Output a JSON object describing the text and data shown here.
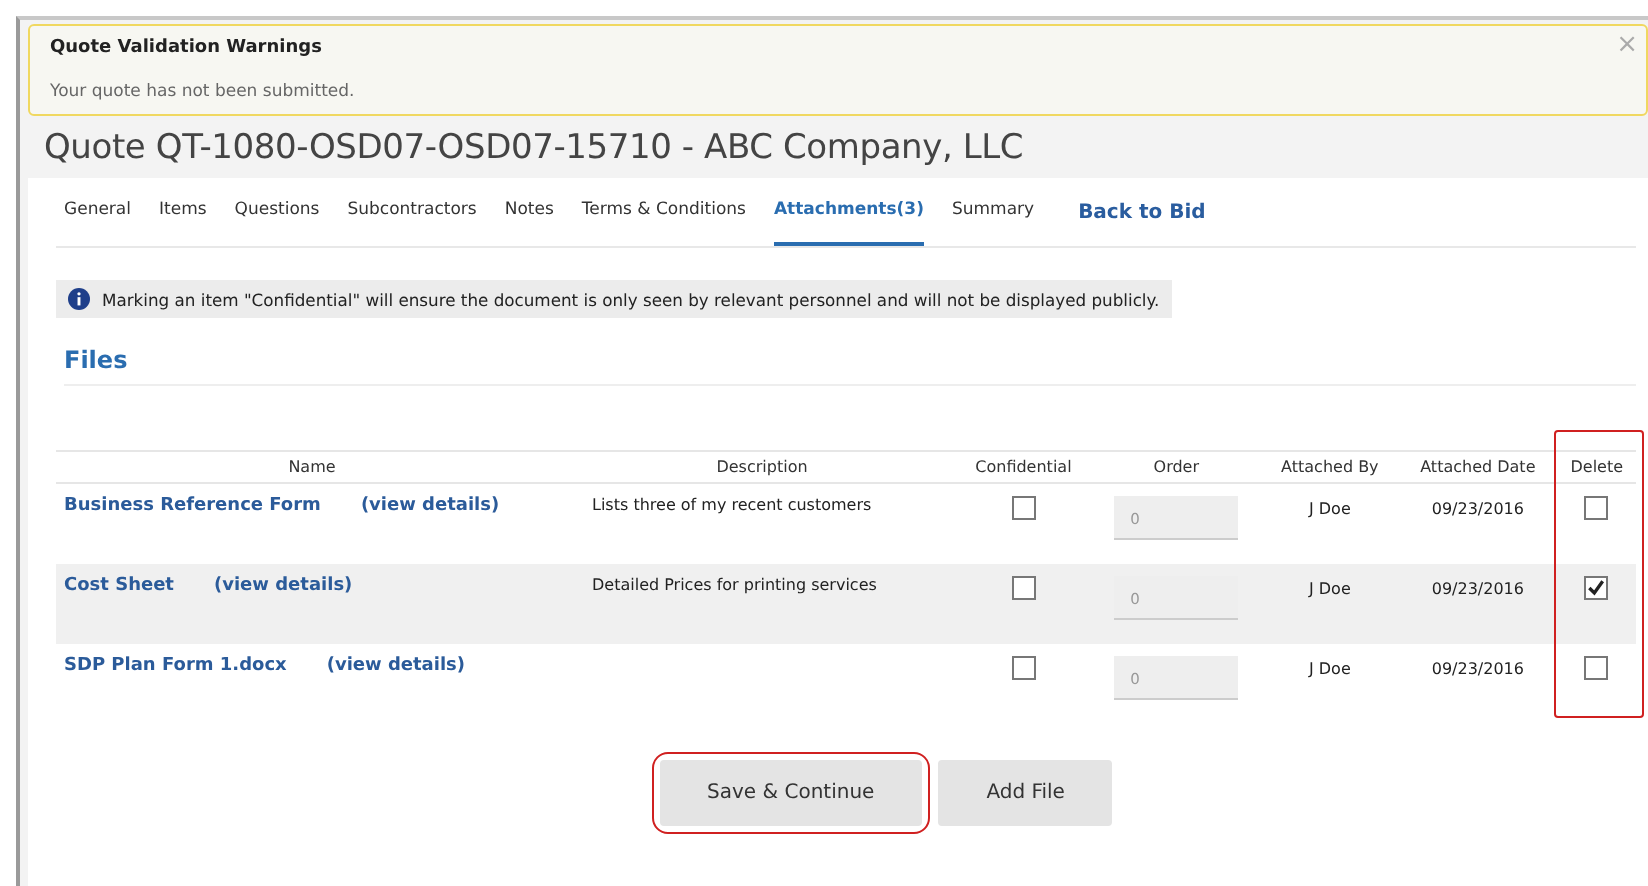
{
  "warning": {
    "title": "Quote Validation Warnings",
    "message": "Your quote has not been submitted.",
    "close": "×"
  },
  "page_title": "Quote QT-1080-OSD07-OSD07-15710 - ABC Company, LLC",
  "tabs": [
    {
      "label": "General",
      "selected": false
    },
    {
      "label": "Items",
      "selected": false
    },
    {
      "label": "Questions",
      "selected": false
    },
    {
      "label": "Subcontractors",
      "selected": false
    },
    {
      "label": "Notes",
      "selected": false
    },
    {
      "label": "Terms & Conditions",
      "selected": false
    },
    {
      "label": "Attachments(3)",
      "selected": true
    },
    {
      "label": "Summary",
      "selected": false
    }
  ],
  "back_link": "Back to Bid",
  "info": "Marking an item \"Confidential\" will ensure the document is only seen by relevant personnel and will not be displayed publicly.",
  "section_title": "Files",
  "table": {
    "columns": [
      {
        "label": "Name",
        "highlighted": false
      },
      {
        "label": "Description",
        "highlighted": false
      },
      {
        "label": "Confidential",
        "highlighted": false
      },
      {
        "label": "Order",
        "highlighted": false
      },
      {
        "label": "Attached By",
        "highlighted": false
      },
      {
        "label": "Attached Date",
        "highlighted": false
      },
      {
        "label": "Delete",
        "highlighted": true
      }
    ],
    "rows": [
      {
        "name": "Business Reference Form",
        "details": "(view details)",
        "description": "Lists three of my recent customers",
        "confidential": false,
        "order": "0",
        "attached_by": "J Doe",
        "attached_date": "09/23/2016",
        "delete": false
      },
      {
        "name": "Cost Sheet",
        "details": "(view details)",
        "description": "Detailed Prices for printing services",
        "confidential": false,
        "order": "0",
        "attached_by": "J Doe",
        "attached_date": "09/23/2016",
        "delete": true
      },
      {
        "name": "SDP Plan Form 1.docx",
        "details": "(view details)",
        "description": "",
        "confidential": false,
        "order": "0",
        "attached_by": "J Doe",
        "attached_date": "09/23/2016",
        "delete": false
      }
    ]
  },
  "buttons": [
    {
      "label": "Save & Continue",
      "highlighted": true
    },
    {
      "label": "Add File",
      "highlighted": false
    }
  ]
}
